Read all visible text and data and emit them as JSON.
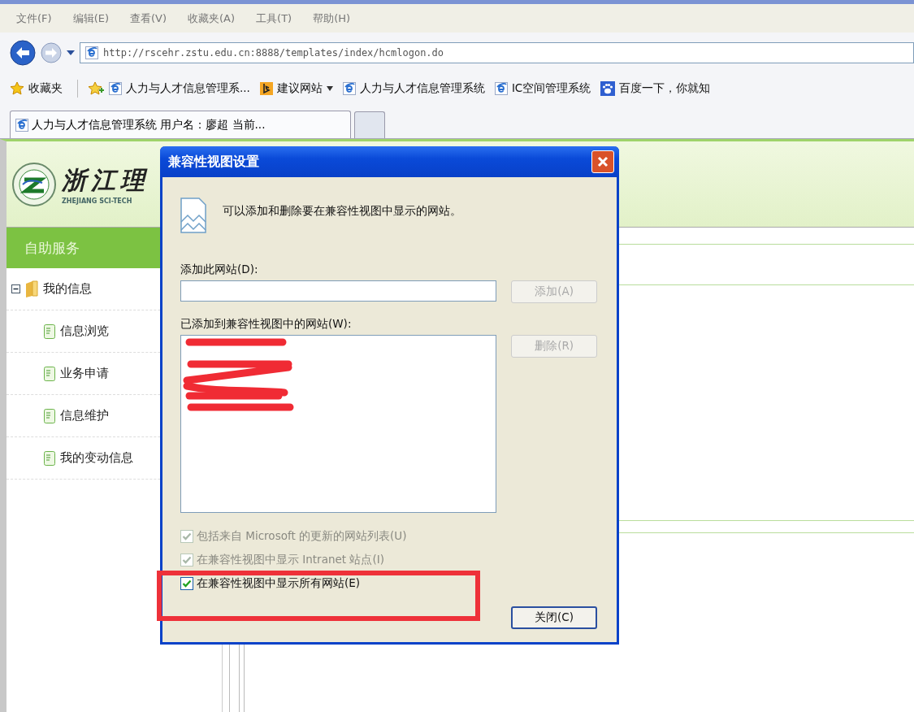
{
  "menu_bar": [
    {
      "label": "文件(F)"
    },
    {
      "label": "编辑(E)"
    },
    {
      "label": "查看(V)"
    },
    {
      "label": "收藏夹(A)"
    },
    {
      "label": "工具(T)"
    },
    {
      "label": "帮助(H)"
    }
  ],
  "address_bar": {
    "url": "http://rscehr.zstu.edu.cn:8888/templates/index/hcmlogon.do"
  },
  "favorites_bar": {
    "label": "收藏夹",
    "items": [
      {
        "label": "人力与人才信息管理系...",
        "kind": "ie",
        "dropdown": false
      },
      {
        "label": "建议网站",
        "kind": "bing",
        "dropdown": true
      },
      {
        "label": "人力与人才信息管理系统",
        "kind": "ie",
        "dropdown": false
      },
      {
        "label": "IC空间管理系统",
        "kind": "ie",
        "dropdown": false
      },
      {
        "label": "百度一下，你就知",
        "kind": "paw",
        "dropdown": false
      }
    ]
  },
  "tabs": [
    {
      "label": "人力与人才信息管理系统 用户名：廖超  当前...",
      "selected": true
    }
  ],
  "site": {
    "logo_text": "浙江理",
    "logo_subtitle": "ZHEJIANG SCI-TECH",
    "sidebar_title": "自助服务",
    "tree": [
      {
        "label": "我的信息",
        "expanded": true,
        "children": [
          {
            "label": "信息浏览"
          },
          {
            "label": "业务申请"
          },
          {
            "label": "信息维护"
          },
          {
            "label": "我的变动信息"
          }
        ]
      }
    ]
  },
  "dialog": {
    "title": "兼容性视图设置",
    "message": "可以添加和删除要在兼容性视图中显示的网站。",
    "add_label": "添加此网站(D):",
    "add_button": {
      "label": "添加(A)",
      "disabled": true
    },
    "list_label": "已添加到兼容性视图中的网站(W):",
    "remove_button": {
      "label": "删除(R)",
      "disabled": true
    },
    "checkboxes": [
      {
        "label": "包括来自 Microsoft 的更新的网站列表(U)",
        "checked": true,
        "disabled": true
      },
      {
        "label": "在兼容性视图中显示 Intranet 站点(I)",
        "checked": true,
        "disabled": true
      },
      {
        "label": "在兼容性视图中显示所有网站(E)",
        "checked": true,
        "disabled": false
      }
    ],
    "close_button": {
      "label": "关闭(C)"
    }
  }
}
